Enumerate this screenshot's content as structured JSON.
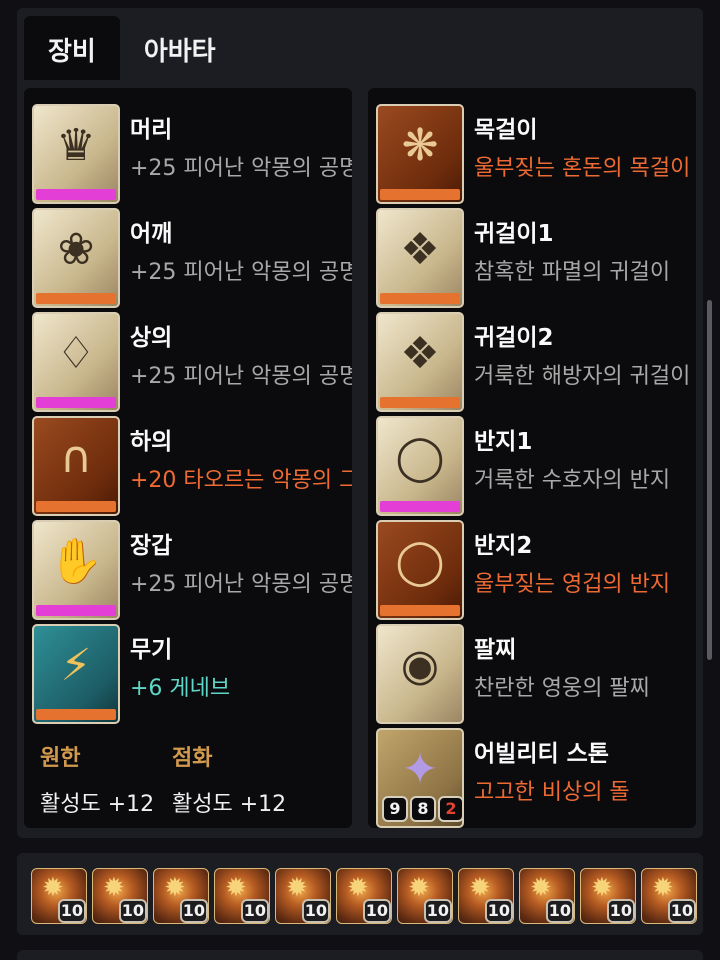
{
  "tabs": [
    {
      "label": "장비",
      "active": true
    },
    {
      "label": "아바타",
      "active": false
    }
  ],
  "colors": {
    "quality_pink": "#e33fd6",
    "quality_orange": "#e67230",
    "desc_orange": "#ee6a33",
    "desc_teal": "#5fd6c8",
    "desc_gray": "#a8a8a8",
    "stat_title": "#d29a4d"
  },
  "equipment_left": [
    {
      "slot": "머리",
      "item": "+25 피어난 악몽의 공명",
      "icon": "helmet-icon",
      "tier": "ancient",
      "desc_color": "gray",
      "quality_color": "pink"
    },
    {
      "slot": "어깨",
      "item": "+25 피어난 악몽의 공명",
      "icon": "shoulder-icon",
      "tier": "ancient",
      "desc_color": "gray",
      "quality_color": "orange"
    },
    {
      "slot": "상의",
      "item": "+25 피어난 악몽의 공명",
      "icon": "chest-armor-icon",
      "tier": "ancient",
      "desc_color": "gray",
      "quality_color": "pink"
    },
    {
      "slot": "하의",
      "item": "+20 타오르는 악몽의 그",
      "icon": "pants-icon",
      "tier": "relic",
      "desc_color": "orange",
      "quality_color": "orange"
    },
    {
      "slot": "장갑",
      "item": "+25 피어난 악몽의 공명",
      "icon": "gloves-icon",
      "tier": "ancient",
      "desc_color": "gray",
      "quality_color": "pink"
    },
    {
      "slot": "무기",
      "item": "+6 게네브",
      "icon": "weapon-icon",
      "tier": "esther",
      "desc_color": "teal",
      "quality_color": "orange"
    }
  ],
  "equipment_right": [
    {
      "slot": "목걸이",
      "item": "울부짖는 혼돈의 목걸이",
      "icon": "necklace-icon",
      "tier": "relic",
      "desc_color": "orange",
      "quality_color": "orange"
    },
    {
      "slot": "귀걸이1",
      "item": "참혹한 파멸의 귀걸이",
      "icon": "earring-icon",
      "tier": "ancient",
      "desc_color": "gray",
      "quality_color": "orange"
    },
    {
      "slot": "귀걸이2",
      "item": "거룩한 해방자의 귀걸이",
      "icon": "earring-icon",
      "tier": "ancient",
      "desc_color": "gray",
      "quality_color": "orange"
    },
    {
      "slot": "반지1",
      "item": "거룩한 수호자의 반지",
      "icon": "ring-icon",
      "tier": "ancient",
      "desc_color": "gray",
      "quality_color": "pink"
    },
    {
      "slot": "반지2",
      "item": "울부짖는 영겁의 반지",
      "icon": "ring-icon",
      "tier": "relic",
      "desc_color": "orange",
      "quality_color": "orange"
    },
    {
      "slot": "팔찌",
      "item": "찬란한 영웅의 팔찌",
      "icon": "bracelet-icon",
      "tier": "ancient",
      "desc_color": "gray",
      "quality_color": "none"
    }
  ],
  "ability_stone": {
    "slot": "어빌리티 스톤",
    "item": "고고한 비상의 돌",
    "icon": "crystal-icon",
    "facets": [
      "9",
      "8",
      "2"
    ]
  },
  "elixir": {
    "title_left": "원한",
    "value_left": "활성도 +12",
    "title_right": "점화",
    "value_right": "활성도 +12"
  },
  "gems": [
    {
      "level": "10",
      "icon": "gem-icon"
    },
    {
      "level": "10",
      "icon": "gem-icon"
    },
    {
      "level": "10",
      "icon": "gem-icon"
    },
    {
      "level": "10",
      "icon": "gem-icon"
    },
    {
      "level": "10",
      "icon": "gem-icon"
    },
    {
      "level": "10",
      "icon": "gem-icon"
    },
    {
      "level": "10",
      "icon": "gem-icon"
    },
    {
      "level": "10",
      "icon": "gem-icon"
    },
    {
      "level": "10",
      "icon": "gem-icon"
    },
    {
      "level": "10",
      "icon": "gem-icon"
    },
    {
      "level": "10",
      "icon": "gem-icon"
    }
  ]
}
